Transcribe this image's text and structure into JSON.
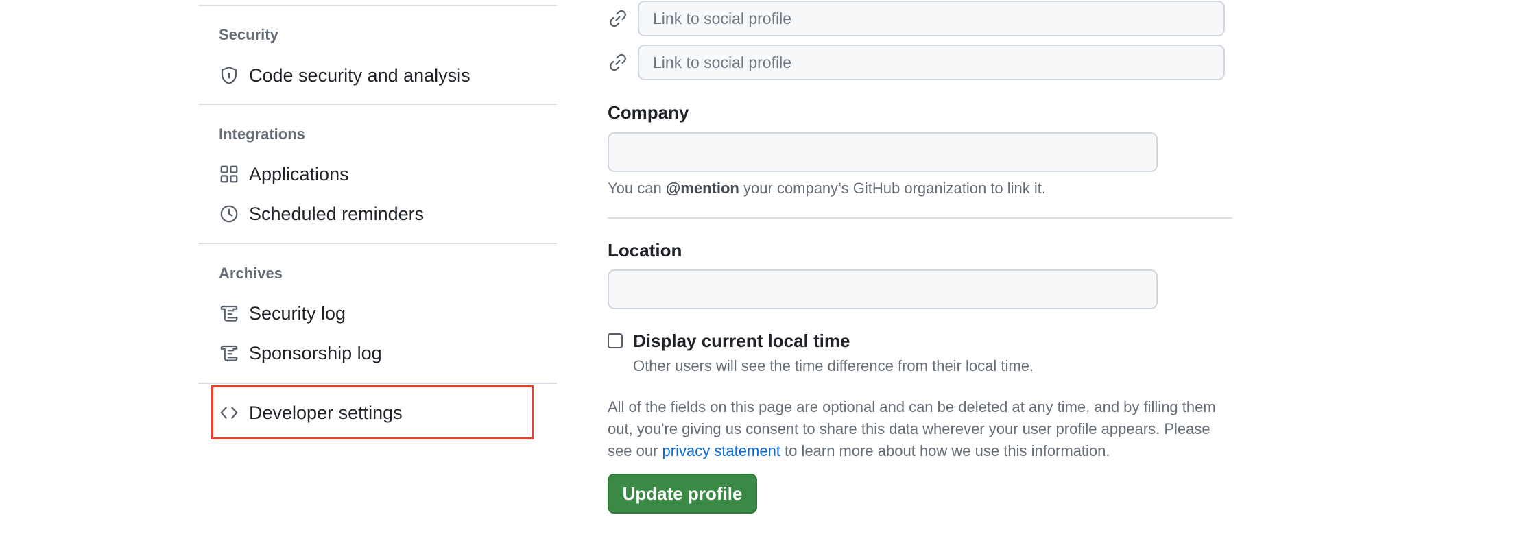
{
  "sidebar": {
    "sections": [
      {
        "heading": "Security",
        "items": [
          {
            "label": "Code security and analysis",
            "icon": "shield-icon"
          }
        ]
      },
      {
        "heading": "Integrations",
        "items": [
          {
            "label": "Applications",
            "icon": "apps-grid-icon"
          },
          {
            "label": "Scheduled reminders",
            "icon": "clock-icon"
          }
        ]
      },
      {
        "heading": "Archives",
        "items": [
          {
            "label": "Security log",
            "icon": "log-icon"
          },
          {
            "label": "Sponsorship log",
            "icon": "log-icon"
          }
        ]
      }
    ],
    "developer_settings": {
      "label": "Developer settings",
      "icon": "code-icon",
      "highlighted": true,
      "highlight_color": "#e5432d"
    }
  },
  "profile_form": {
    "social_links": [
      {
        "placeholder": "Link to social profile",
        "icon": "link-icon"
      },
      {
        "placeholder": "Link to social profile",
        "icon": "link-icon"
      }
    ],
    "company": {
      "label": "Company",
      "value": "",
      "note_prefix": "You can",
      "note_mention": "@mention",
      "note_suffix": "your company’s GitHub organization to link it."
    },
    "location": {
      "label": "Location",
      "value": ""
    },
    "local_time": {
      "label": "Display current local time",
      "checked": false,
      "note": "Other users will see the time difference from their local time."
    },
    "consent": {
      "text_before": "All of the fields on this page are optional and can be deleted at any time, and by filling them out, you're giving us consent to share this data wherever your user profile appears. Please see our",
      "link_text": "privacy statement",
      "text_after": "to learn more about how we use this information."
    },
    "submit_label": "Update profile"
  },
  "colors": {
    "accent_link": "#0969da",
    "primary_button": "#3a8a45",
    "muted_text": "#656d76"
  }
}
